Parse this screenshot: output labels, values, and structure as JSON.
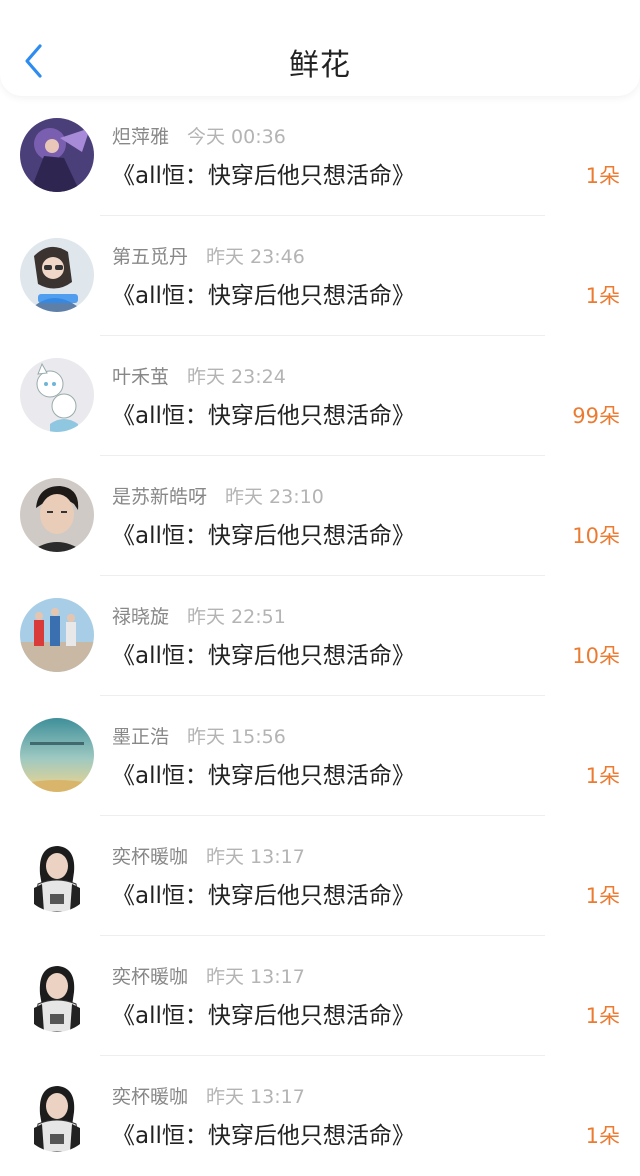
{
  "header": {
    "title": "鲜花",
    "back_icon": "chevron-left-icon",
    "accent_color": "#2d8cf0"
  },
  "flower_color": "#ec7b32",
  "records": [
    {
      "username": "炟萍雅",
      "time": "今天 00:36",
      "book": "《all恒：快穿后他只想活命》",
      "count": "1朵"
    },
    {
      "username": "第五觅丹",
      "time": "昨天 23:46",
      "book": "《all恒：快穿后他只想活命》",
      "count": "1朵"
    },
    {
      "username": "叶禾茧",
      "time": "昨天 23:24",
      "book": "《all恒：快穿后他只想活命》",
      "count": "99朵"
    },
    {
      "username": "是苏新皓呀",
      "time": "昨天 23:10",
      "book": "《all恒：快穿后他只想活命》",
      "count": "10朵"
    },
    {
      "username": "禄晓旋",
      "time": "昨天 22:51",
      "book": "《all恒：快穿后他只想活命》",
      "count": "10朵"
    },
    {
      "username": "墨正浩",
      "time": "昨天 15:56",
      "book": "《all恒：快穿后他只想活命》",
      "count": "1朵"
    },
    {
      "username": "奕杯暖咖",
      "time": "昨天 13:17",
      "book": "《all恒：快穿后他只想活命》",
      "count": "1朵"
    },
    {
      "username": "奕杯暖咖",
      "time": "昨天 13:17",
      "book": "《all恒：快穿后他只想活命》",
      "count": "1朵"
    },
    {
      "username": "奕杯暖咖",
      "time": "昨天 13:17",
      "book": "《all恒：快穿后他只想活命》",
      "count": "1朵"
    }
  ]
}
